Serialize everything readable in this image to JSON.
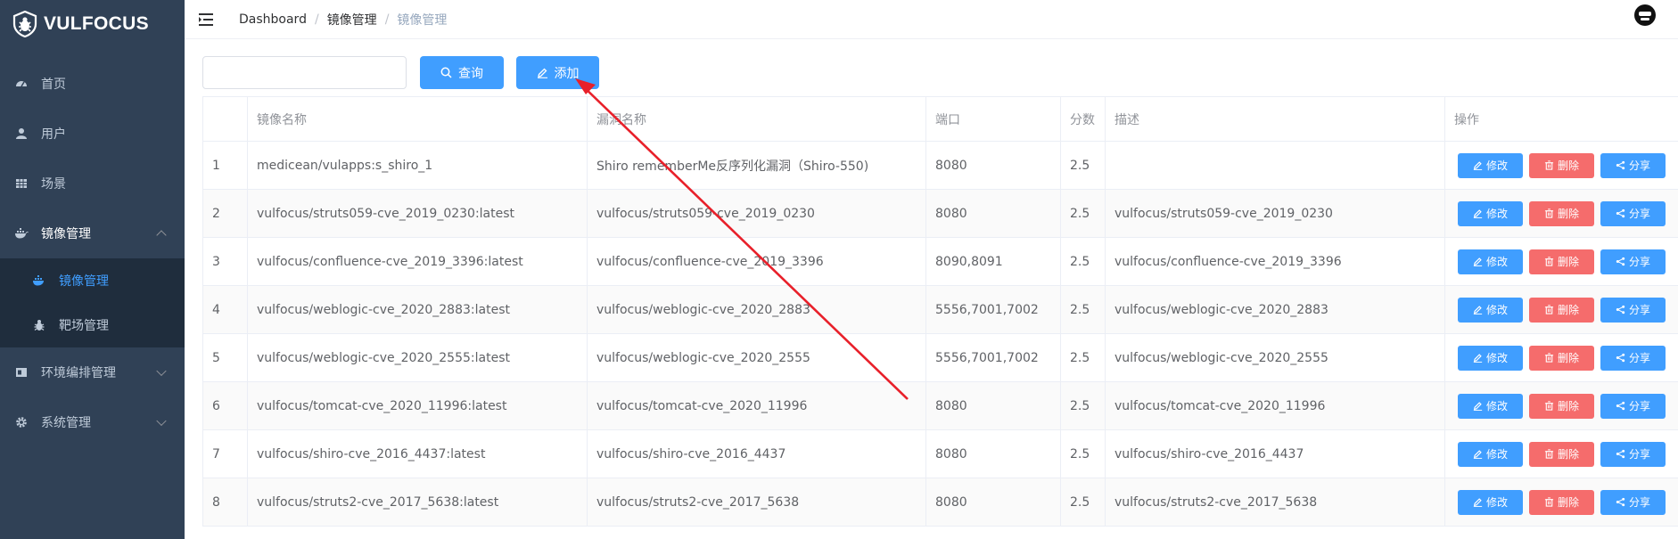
{
  "app": {
    "logo_text": "VULFOCUS"
  },
  "sidebar": {
    "items": [
      {
        "label": "首页",
        "icon": "dashboard-icon"
      },
      {
        "label": "用户",
        "icon": "user-icon"
      },
      {
        "label": "场景",
        "icon": "table-icon"
      },
      {
        "label": "镜像管理",
        "icon": "docker-icon"
      },
      {
        "label": "环境编排管理",
        "icon": "layout-icon"
      },
      {
        "label": "系统管理",
        "icon": "gear-icon"
      }
    ],
    "sub_items": [
      {
        "label": "镜像管理",
        "icon": "docker-icon"
      },
      {
        "label": "靶场管理",
        "icon": "bug-icon"
      }
    ]
  },
  "header": {
    "breadcrumb": [
      "Dashboard",
      "镜像管理",
      "镜像管理"
    ]
  },
  "toolbar": {
    "search_placeholder": "",
    "query_label": "查询",
    "add_label": "添加"
  },
  "table": {
    "headers": [
      "",
      "镜像名称",
      "漏洞名称",
      "端口",
      "分数",
      "描述",
      "操作"
    ],
    "ops": {
      "edit": "修改",
      "delete": "删除",
      "share": "分享"
    },
    "rows": [
      [
        "1",
        "medicean/vulapps:s_shiro_1",
        "Shiro rememberMe反序列化漏洞（Shiro-550)",
        "8080",
        "2.5",
        ""
      ],
      [
        "2",
        "vulfocus/struts059-cve_2019_0230:latest",
        "vulfocus/struts059-cve_2019_0230",
        "8080",
        "2.5",
        "vulfocus/struts059-cve_2019_0230"
      ],
      [
        "3",
        "vulfocus/confluence-cve_2019_3396:latest",
        "vulfocus/confluence-cve_2019_3396",
        "8090,8091",
        "2.5",
        "vulfocus/confluence-cve_2019_3396"
      ],
      [
        "4",
        "vulfocus/weblogic-cve_2020_2883:latest",
        "vulfocus/weblogic-cve_2020_2883",
        "5556,7001,7002",
        "2.5",
        "vulfocus/weblogic-cve_2020_2883"
      ],
      [
        "5",
        "vulfocus/weblogic-cve_2020_2555:latest",
        "vulfocus/weblogic-cve_2020_2555",
        "5556,7001,7002",
        "2.5",
        "vulfocus/weblogic-cve_2020_2555"
      ],
      [
        "6",
        "vulfocus/tomcat-cve_2020_11996:latest",
        "vulfocus/tomcat-cve_2020_11996",
        "8080",
        "2.5",
        "vulfocus/tomcat-cve_2020_11996"
      ],
      [
        "7",
        "vulfocus/shiro-cve_2016_4437:latest",
        "vulfocus/shiro-cve_2016_4437",
        "8080",
        "2.5",
        "vulfocus/shiro-cve_2016_4437"
      ],
      [
        "8",
        "vulfocus/struts2-cve_2017_5638:latest",
        "vulfocus/struts2-cve_2017_5638",
        "8080",
        "2.5",
        "vulfocus/struts2-cve_2017_5638"
      ]
    ]
  },
  "colors": {
    "sidebar_bg": "#304156",
    "submenu_bg": "#1f2d3d",
    "primary": "#409eff",
    "danger": "#f56c6c",
    "annotation_arrow": "#e8202a"
  }
}
